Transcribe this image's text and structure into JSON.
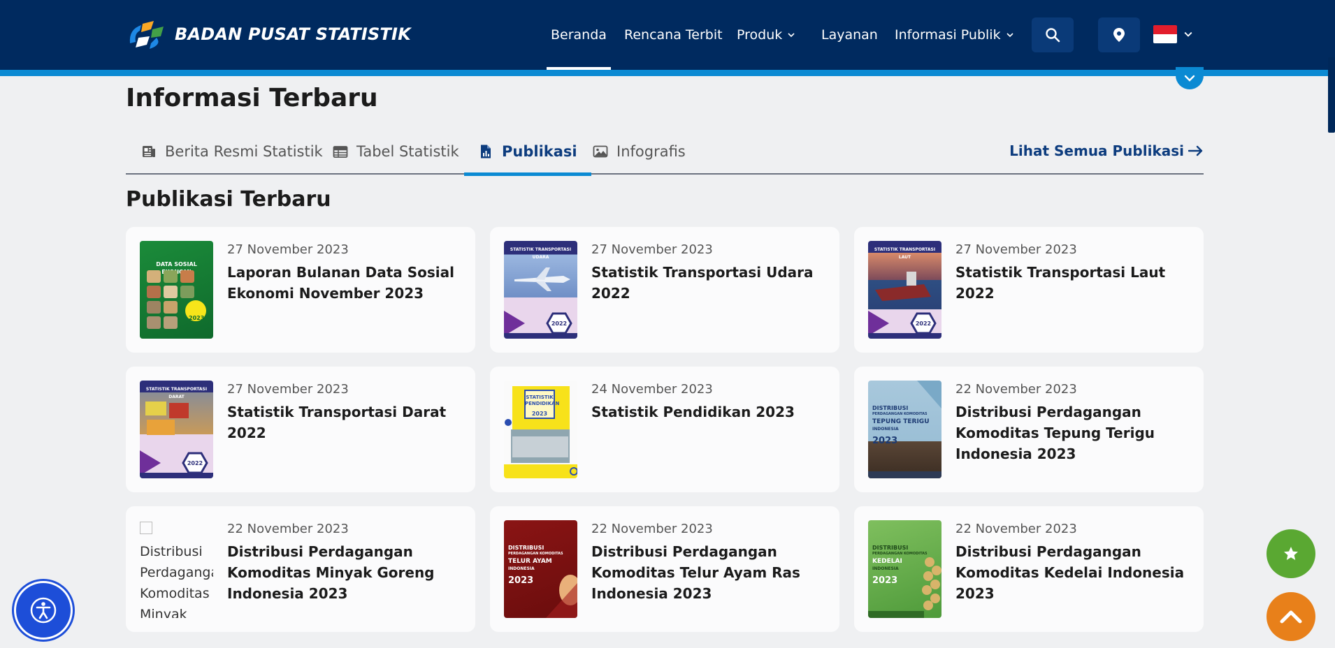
{
  "header": {
    "brand": "BADAN PUSAT STATISTIK",
    "nav": [
      {
        "label": "Beranda"
      },
      {
        "label": "Rencana Terbit"
      },
      {
        "label": "Produk"
      },
      {
        "label": "Layanan"
      },
      {
        "label": "Informasi Publik"
      }
    ],
    "icons": {
      "search": "search-icon",
      "location": "location-pin-icon",
      "language": "indonesia-flag-icon"
    }
  },
  "section": {
    "title": "Informasi Terbaru",
    "tabs": [
      {
        "label": "Berita Resmi Statistik",
        "icon": "newspaper-icon"
      },
      {
        "label": "Tabel Statistik",
        "icon": "table-icon"
      },
      {
        "label": "Publikasi",
        "icon": "document-chart-icon"
      },
      {
        "label": "Infografis",
        "icon": "image-icon"
      }
    ],
    "see_all": "Lihat Semua Publikasi"
  },
  "publications": {
    "title": "Publikasi Terbaru",
    "items": [
      {
        "date": "27 November 2023",
        "title": "Laporan Bulanan Data Sosial Ekonomi November 2023"
      },
      {
        "date": "27 November 2023",
        "title": "Statistik Transportasi Udara 2022"
      },
      {
        "date": "27 November 2023",
        "title": "Statistik Transportasi Laut 2022"
      },
      {
        "date": "27 November 2023",
        "title": "Statistik Transportasi Darat 2022"
      },
      {
        "date": "24 November 2023",
        "title": "Statistik Pendidikan 2023"
      },
      {
        "date": "22 November 2023",
        "title": "Distribusi Perdagangan Komoditas Tepung Terigu Indonesia 2023"
      },
      {
        "date": "22 November 2023",
        "title": "Distribusi Perdagangan Komoditas Minyak Goreng Indonesia 2023",
        "alt": "Distribusi Perdagangan Komoditas Minyak"
      },
      {
        "date": "22 November 2023",
        "title": "Distribusi Perdagangan Komoditas Telur Ayam Ras Indonesia 2023"
      },
      {
        "date": "22 November 2023",
        "title": "Distribusi Perdagangan Komoditas Kedelai Indonesia 2023"
      }
    ]
  },
  "covers": {
    "c1": {
      "label": "DATA SOSIAL EKONOMI",
      "year": "2023"
    },
    "c2": {
      "label": "STATISTIK TRANSPORTASI UDARA",
      "year": "2022"
    },
    "c3": {
      "label": "STATISTIK TRANSPORTASI LAUT",
      "year": "2022"
    },
    "c4": {
      "label": "STATISTIK TRANSPORTASI DARAT",
      "year": "2022"
    },
    "c5": {
      "label": "STATISTIK PENDIDIKAN",
      "year": "2023"
    },
    "c6": {
      "label1": "DISTRIBUSI",
      "label2": "PERDAGANGAN KOMODITAS",
      "label3": "TEPUNG TERIGU",
      "label4": "INDONESIA",
      "year": "2023"
    },
    "c8": {
      "label1": "DISTRIBUSI",
      "label2": "PERDAGANGAN KOMODITAS",
      "label3": "TELUR AYAM",
      "label4": "INDONESIA",
      "year": "2023"
    },
    "c9": {
      "label1": "DISTRIBUSI",
      "label2": "PERDAGANGAN KOMODITAS",
      "label3": "KEDELAI",
      "label4": "INDONESIA",
      "year": "2023"
    }
  },
  "floating": {
    "favorite": "star-icon",
    "scroll_top": "chevron-up-icon",
    "accessibility": "accessibility-icon"
  },
  "colors": {
    "header": "#002a5f",
    "accent": "#0b8ad3",
    "link": "#0d3c7e",
    "favorite": "#5aa832",
    "scroll_top": "#e8801a"
  }
}
